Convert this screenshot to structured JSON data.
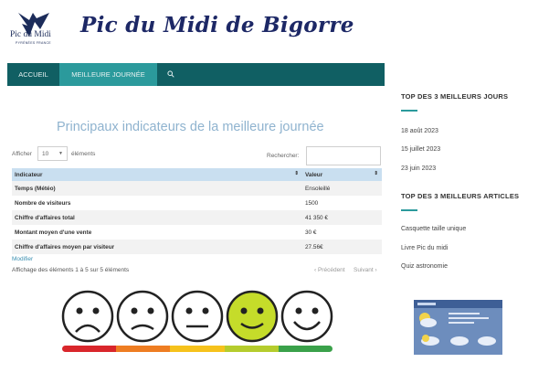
{
  "header": {
    "logo_line1": "Pic du Midi",
    "logo_line2": "PYRÉNÉES FRANCE",
    "site_title": "Pic du Midi de Bigorre"
  },
  "nav": {
    "items": [
      {
        "label": "ACCUEIL"
      },
      {
        "label": "MEILLEURE JOURNÉE"
      }
    ],
    "search_icon": "search-icon"
  },
  "main": {
    "title": "Principaux indicateurs de la meilleure journée",
    "show_label": "Afficher",
    "show_value": "10",
    "elements_label": "éléments",
    "search_label": "Rechercher:",
    "table": {
      "headers": [
        "Indicateur",
        "Valeur"
      ],
      "rows": [
        {
          "label": "Temps (Météo)",
          "value": "Ensoleillé"
        },
        {
          "label": "Nombre de visiteurs",
          "value": "1500"
        },
        {
          "label": "Chiffre d'affaires total",
          "value": "41 350 €"
        },
        {
          "label": "Montant moyen d'une vente",
          "value": "30 €"
        },
        {
          "label": "Chiffre d'affaires moyen par visiteur",
          "value": "27.56€"
        }
      ]
    },
    "modifier": "Modifier",
    "info": "Affichage des éléments 1 à 5 sur 5 éléments",
    "prev": "Précédent",
    "next": "Suivant"
  },
  "satisfaction": {
    "faces": [
      "very-sad-face-icon",
      "sad-face-icon",
      "neutral-face-icon",
      "happy-face-icon",
      "very-happy-face-icon"
    ],
    "selected_index": 3,
    "colors": [
      "#d9262b",
      "#ee7d22",
      "#f6c21c",
      "#b5cc2d",
      "#3aa14a"
    ],
    "selected_color": "#c5dc2a"
  },
  "sidebar": {
    "top_days_heading": "TOP DES 3 MEILLEURS JOURS",
    "top_days": [
      "18 août 2023",
      "15 juillet 2023",
      "23 juin 2023"
    ],
    "top_articles_heading": "TOP DES 3 MEILLEURS ARTICLES",
    "top_articles": [
      "Casquette taille unique",
      "Livre Pic du midi",
      "Quiz astronomie"
    ],
    "widget_icon": "weather-widget-icon"
  },
  "colors": {
    "nav_bg": "#105f63",
    "nav_active": "#2b9a9c",
    "title_blue": "#8fb3cf",
    "table_header": "#c9dff0",
    "accent": "#2b9a9c"
  }
}
